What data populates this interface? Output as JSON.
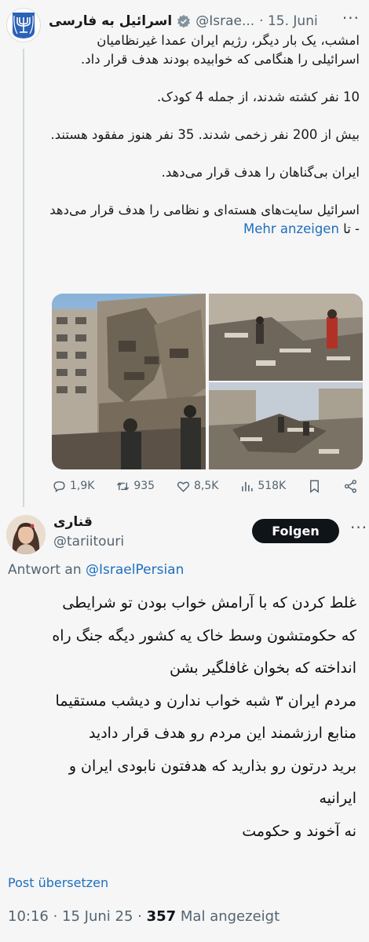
{
  "parent_tweet": {
    "display_name": "اسرائیل به فارسی",
    "handle": "@Israe...",
    "date": "· 15. Juni",
    "more": "···",
    "paragraphs": [
      "امشب، یک بار دیگر، رژیم ایران عمدا غیرنظامیان اسرائیلی را هنگامی که خوابیده بودند هدف قرار داد.",
      "10 نفر کشته شدند، از جمله 4 کودک.",
      "بیش از 200 نفر زخمی شدند. 35 نفر هنوز مفقود هستند.",
      "ایران بی‌گناهان را هدف قرار می‌دهد."
    ],
    "truncated_text": "اسرائیل سایت‌های هسته‌ای و نظامی را هدف قرار می‌دهد - تا",
    "show_more": "Mehr anzeigen",
    "stats": {
      "replies": "1,9K",
      "reposts": "935",
      "likes": "8,5K",
      "views": "518K"
    }
  },
  "reply_tweet": {
    "display_name": "قناری",
    "handle": "@tariitouri",
    "follow_label": "Folgen",
    "more": "···",
    "reply_to_prefix": "Antwort an",
    "reply_to_mention": "@IsraelPersian",
    "lines": [
      "غلط کردن که با آرامش خواب بودن تو شرایطی",
      "که حکومتشون وسط خاک یه کشور دیگه جنگ راه",
      "انداخته که بخوان غافلگیر بشن",
      "مردم ایران ۳ شبه خواب ندارن و دیشب مستقیما",
      "منابع ارزشمند این مردم رو هدف قرار دادید",
      "برید درتون رو بذارید که هدفتون نابودی ایران و",
      "ایرانیه",
      "نه آخوند و حکومت"
    ],
    "translate_label": "Post übersetzen",
    "time": "10:16 · 15 Juni 25 ·",
    "views_count": "357",
    "views_label": "Mal angezeigt"
  },
  "colors": {
    "link": "#1d6fbf",
    "muted": "#536471",
    "follow_bg": "#0f1419"
  }
}
